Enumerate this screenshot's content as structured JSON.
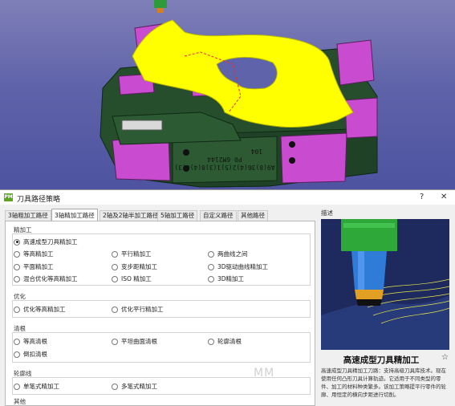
{
  "dialog": {
    "title": "刀具路径策略",
    "help_label": "?",
    "close_label": "✕",
    "app_icon_text": "PM"
  },
  "tabs": [
    {
      "label": "3轴粗加工路径",
      "active": false
    },
    {
      "label": "3轴精加工路径",
      "active": true
    },
    {
      "label": "2轴及2轴半加工路径",
      "active": false
    },
    {
      "label": "5轴加工路径",
      "active": false
    },
    {
      "label": "自定义路径",
      "active": false
    },
    {
      "label": "其他路径",
      "active": false
    }
  ],
  "sections": {
    "finishing": {
      "title": "精加工",
      "options": [
        {
          "label": "高速成型刀具精加工",
          "selected": true
        },
        {
          "label": "等高精加工"
        },
        {
          "label": "平行精加工"
        },
        {
          "label": "两曲线之间"
        },
        {
          "label": "平面精加工"
        },
        {
          "label": "变步距精加工"
        },
        {
          "label": "3D驱动曲线精加工"
        },
        {
          "label": "混合优化等高精加工"
        },
        {
          "label": "ISO 精加工"
        },
        {
          "label": "3D精加工"
        }
      ]
    },
    "optimize": {
      "title": "优化",
      "options": [
        {
          "label": "优化等高精加工"
        },
        {
          "label": "优化平行精加工"
        }
      ]
    },
    "cleanup": {
      "title": "清根",
      "options": [
        {
          "label": "等高清根"
        },
        {
          "label": "平坦曲面清根"
        },
        {
          "label": "轮廓清根"
        },
        {
          "label": "倒扣清根"
        }
      ]
    },
    "contour": {
      "title": "轮廓线",
      "options": [
        {
          "label": "单笔式精加工"
        },
        {
          "label": "多笔式精加工"
        }
      ]
    },
    "other": {
      "title": "其他"
    }
  },
  "description": {
    "label": "描述",
    "title": "高速成型刀具精加工",
    "star_label": "☆",
    "text": "高速成型刀具精加工刀路：支持高级刀具库技术。现在使用任何凸形刀具计算轨迹。它适用于不同类型的零件、加工的材料种类繁多。该加工策略提平行零件的轮廓、用恒定的横向步距进行切削。"
  },
  "viewport": {
    "part_engraving": "A9(8)36(4)2(5)1(3)8(4)6(3)",
    "part_text_2": "P0 6M2144",
    "part_text_3": "104"
  },
  "watermark": "MM",
  "colors": {
    "surface_yellow": "#ffff00",
    "magenta_block": "#c84bd0",
    "part_green": "#264d2c",
    "viewport_blue": "#5f63a9"
  }
}
